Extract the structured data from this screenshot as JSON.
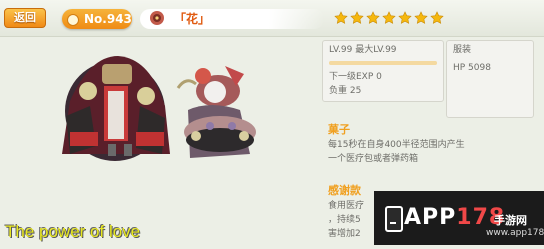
{
  "header": {
    "back_label": "返回",
    "number": "No.943",
    "name": "「花」",
    "star_count": 7
  },
  "caption": "The power of love",
  "stats_main": {
    "level": "LV.99 最大LV.99",
    "next_exp": "下一级EXP 0",
    "load": "负重 25"
  },
  "stats_side": {
    "category": "服装",
    "hp": "HP 5098"
  },
  "skill_1": {
    "title": "菓子",
    "line1": "每15秒在自身400半径范围内产生",
    "line2": "一个医疗包或者弹药箱"
  },
  "skill_2": {
    "title": "感谢款",
    "line1": "食用医疗",
    "line2": "，持续5",
    "line3": "害增加2"
  },
  "watermark": {
    "brand_a": "APP",
    "brand_b": "178",
    "brand_cn": "手游网",
    "url": "www.app178.com"
  },
  "colors": {
    "accent_orange": "#f08a16",
    "star_yellow": "#f5b80e",
    "caption_yellow": "#e8e820"
  }
}
